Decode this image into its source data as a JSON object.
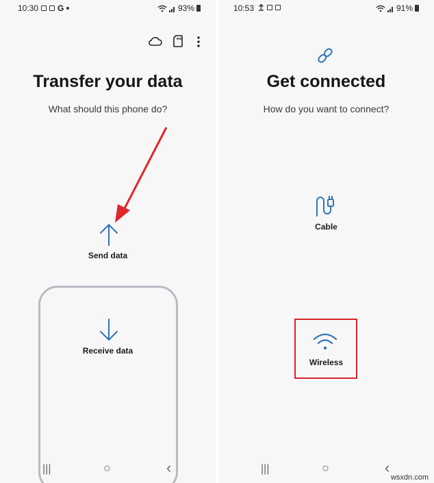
{
  "left_screen": {
    "status": {
      "time": "10:30",
      "notification_icons": [
        "image-icon",
        "check-box-icon",
        "google-g-icon",
        "dot-icon"
      ],
      "google_letter": "G",
      "battery": "93%"
    },
    "toolbar": {
      "icons": [
        "cloud-icon",
        "sd-card-icon",
        "more-vert-icon"
      ]
    },
    "title": "Transfer your data",
    "subtitle": "What should this phone do?",
    "options": {
      "send_label": "Send data",
      "receive_label": "Receive data"
    },
    "annotation": {
      "arrow_color": "#e0262b",
      "points_to": "Send data"
    }
  },
  "right_screen": {
    "status": {
      "time": "10:53",
      "notification_icons": [
        "upload-icon",
        "image-icon",
        "image-icon"
      ],
      "battery": "91%"
    },
    "title": "Get connected",
    "subtitle": "How do you want to connect?",
    "options": {
      "cable_label": "Cable",
      "wireless_label": "Wireless"
    },
    "annotation": {
      "highlight_color": "#d6262c",
      "highlighted": "Wireless"
    }
  },
  "navbar": {
    "recents": "|||",
    "home": "○",
    "back": "‹"
  },
  "watermark": "wsxdn.com",
  "colors": {
    "accent_blue": "#2f74b5",
    "background": "#f7f7f8"
  }
}
